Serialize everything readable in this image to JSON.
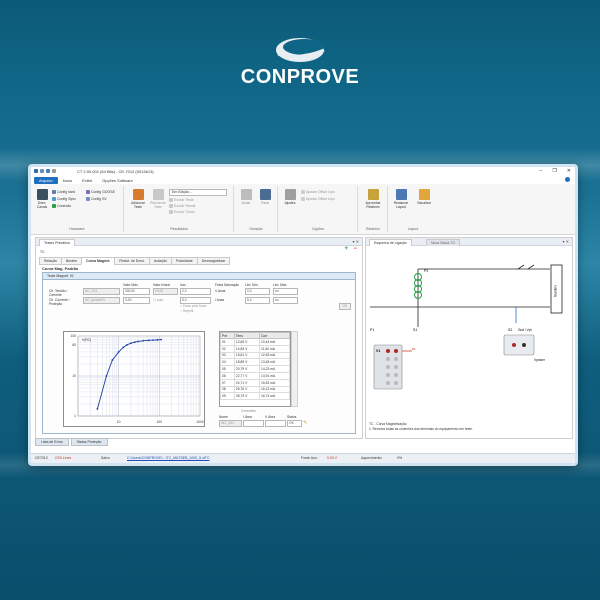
{
  "brand": {
    "name": "CONPROVE"
  },
  "window": {
    "title": "CT 2.00.001 (64 Bits) - CE-7012 (0013613)",
    "controls": [
      "–",
      "❐",
      "✕"
    ]
  },
  "menu": {
    "items": [
      "Arquivo",
      "Início",
      "Exibir",
      "Opções Software"
    ],
    "active_index": 0
  },
  "ribbon": {
    "hardware": {
      "group_label": "Hardware",
      "direct_channels": "Direc. Canais",
      "config_hard": "Config hard",
      "config_goose": "Config GOOSE",
      "config_sync": "Config Sync",
      "config_sv": "Config SV",
      "connection": "Conexão"
    },
    "resultados": {
      "group_label": "Resultados",
      "add_test": "Adicionar Teste",
      "reorder_test": "Reordenar Teste",
      "dropdown_value": "Em Edição...",
      "delete_test": "Excluir Teste",
      "clear_results": "Excluir Result",
      "reset_results": "Excluir Todos"
    },
    "geracao": {
      "group_label": "Geração",
      "start": "Iniciar",
      "stop": "Parar"
    },
    "opcoes": {
      "group_label": "Opções",
      "adjust": "Ajustes",
      "adjust_offset": "Ajustar Offset Icpo",
      "adjust_offset2": "Ajustar Offset Icpo"
    },
    "relatorio": {
      "group_label": "Relatório",
      "add_report": "Aproveitar Relatório"
    },
    "layout": {
      "group_label": "Layout",
      "restore": "Restaurar Layout",
      "view": "Visualizar"
    }
  },
  "left_panel": {
    "tab": "Testes Primários",
    "device": "TC",
    "tabs": [
      "Relação",
      "Burden",
      "Curva Magnet.",
      "Resist. de Enrol.",
      "Isolação",
      "Polaridade",
      "Desmagnetizar"
    ],
    "active_tab": 2,
    "section_title": "Curva Mag. Padrão",
    "box_title": "Teste Magnet. 01",
    "field_headers": [
      "Valor Máx.",
      "Valor Inicial",
      "Incr.:",
      "Faixa Saturação",
      "Lim. Mín.",
      "Lim. Máx."
    ],
    "row1_label": "Ch. Tensão / Corrente",
    "row2_label": "Ch. Corrente / Proteção",
    "row1_values": [
      "AC_V01",
      "300,00",
      "20,00",
      "2,0",
      "V Anas",
      "0,0",
      "en"
    ],
    "row2_values": [
      "AC_Ipower01",
      "3,00",
      "",
      "5,0",
      "I Anas",
      "5,4",
      "en"
    ],
    "auto_label": "auto",
    "option1": "Parar pela trava",
    "option2": "Repetir",
    "ok_label": "OK",
    "table_headers": [
      "Pnt",
      "Tens",
      "Corr"
    ],
    "table_rows": [
      [
        "01",
        "12,69 V",
        "10,44 mA"
      ],
      [
        "02",
        "14,83 V",
        "11,60 mA"
      ],
      [
        "03",
        "16,61 V",
        "12,63 mA"
      ],
      [
        "04",
        "18,89 V",
        "13,48 mA"
      ],
      [
        "05",
        "20,79 V",
        "14,23 mA"
      ],
      [
        "06",
        "22,77 V",
        "14,91 mA"
      ],
      [
        "07",
        "24,71 V",
        "15,52 mA"
      ],
      [
        "08",
        "26,76 V",
        "16,13 mA"
      ],
      [
        "09",
        "28,79 V",
        "16,74 mA"
      ]
    ],
    "table_foot_label": "Conexões",
    "table_foot_headers": [
      "Nome",
      "I Área",
      "V Área",
      "Status"
    ],
    "table_foot_values": [
      "INC_001",
      "",
      "",
      "OK"
    ],
    "chart_y_ticks": [
      "100",
      "60",
      "10",
      "1"
    ],
    "chart_x_ticks": [
      "10",
      "100",
      "1000"
    ],
    "chart_legend": "V(RC)"
  },
  "right_panel": {
    "tabs": [
      "Esquema de Ligação",
      "Nova Saída TG"
    ],
    "active_tab": 0,
    "labels": {
      "device_box": "Burden",
      "p1": "P1",
      "p2": "P2",
      "s1": "S1",
      "s2": "S2",
      "label_vi": "V1",
      "label_bi": "B1",
      "gnd": "Gnd / Vpt",
      "vpower": "Vpower"
    },
    "note_title": "TC - Curva Magnetização",
    "note_text": "1. Remova todas as conexões dos terminais do equipamento em teste."
  },
  "bottom_tabs": [
    "Lista de Erros",
    "Status Proteção"
  ],
  "status_bar": {
    "device": "CE7012",
    "indicator": "CE6 Lines",
    "file_label": "Salvo",
    "file_path": "C:\\Users\\CONPROVE\\...\\TC_M&TSEB_1000_5.ctTC",
    "source_label": "Fonte Aux:",
    "source_value": "0,00 V",
    "heating_label": "Aquecimento:",
    "heating_value": "0%"
  },
  "chart_data": {
    "type": "line",
    "title": "",
    "xlabel": "",
    "ylabel": "",
    "x_scale": "log",
    "y_scale": "log",
    "series": [
      {
        "name": "V(RC)",
        "x": [
          3,
          5,
          7,
          10,
          13,
          16,
          20,
          25,
          30,
          40,
          55,
          70,
          90,
          110
        ],
        "y": [
          1.5,
          10,
          25,
          40,
          52,
          60,
          66,
          70,
          73,
          76,
          78,
          79,
          80,
          81
        ]
      }
    ],
    "xlim": [
      1,
      1000
    ],
    "ylim": [
      1,
      100
    ],
    "grid": true,
    "colors": {
      "line": "#1c3fa6",
      "marker": "#1c3fa6"
    }
  },
  "colors": {
    "accent": "#1f6fbf",
    "brand_bg": "#0c5a78"
  }
}
